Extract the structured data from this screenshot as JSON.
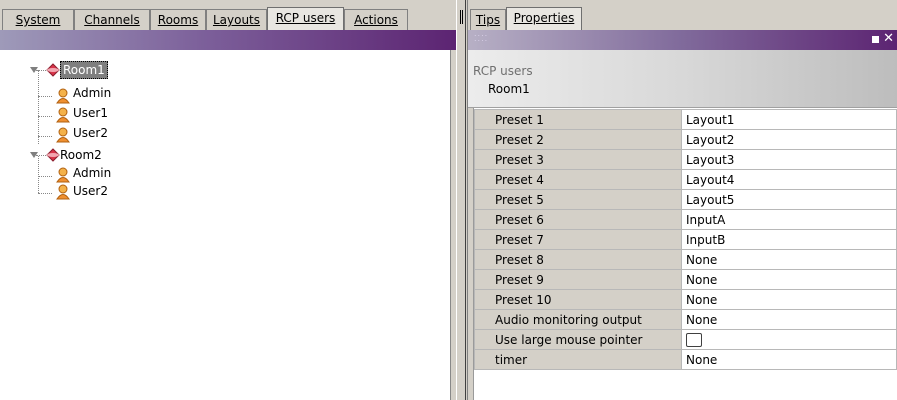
{
  "left_tabs": [
    {
      "label": "System"
    },
    {
      "label": "Channels"
    },
    {
      "label": "Rooms"
    },
    {
      "label": "Layouts"
    },
    {
      "label": "RCP users",
      "active": true
    },
    {
      "label": "Actions"
    }
  ],
  "tree": {
    "rooms": [
      {
        "label": "Room1",
        "selected": true,
        "users": [
          "Admin",
          "User1",
          "User2"
        ]
      },
      {
        "label": "Room2",
        "selected": false,
        "users": [
          "Admin",
          "User2"
        ]
      }
    ]
  },
  "right_tabs": [
    {
      "label": "Tips"
    },
    {
      "label": "Properties",
      "active": true
    }
  ],
  "properties_header": {
    "category": "RCP users",
    "item": "Room1"
  },
  "properties": [
    {
      "name": "Preset 1",
      "value": "Layout1"
    },
    {
      "name": "Preset 2",
      "value": "Layout2"
    },
    {
      "name": "Preset 3",
      "value": "Layout3"
    },
    {
      "name": "Preset 4",
      "value": "Layout4"
    },
    {
      "name": "Preset 5",
      "value": "Layout5"
    },
    {
      "name": "Preset 6",
      "value": "InputA"
    },
    {
      "name": "Preset 7",
      "value": "InputB"
    },
    {
      "name": "Preset 8",
      "value": "None"
    },
    {
      "name": "Preset 9",
      "value": "None"
    },
    {
      "name": "Preset 10",
      "value": "None"
    },
    {
      "name": "Audio monitoring output",
      "value": "None"
    },
    {
      "name": "Use large mouse pointer",
      "value": "",
      "type": "checkbox",
      "checked": false
    },
    {
      "name": "timer",
      "value": "None"
    }
  ],
  "colors": {
    "titlebar_accent": "#5c2472",
    "panel_gray": "#d4d0c8",
    "room_icon": "#d8344a",
    "user_icon": "#f0a030"
  }
}
